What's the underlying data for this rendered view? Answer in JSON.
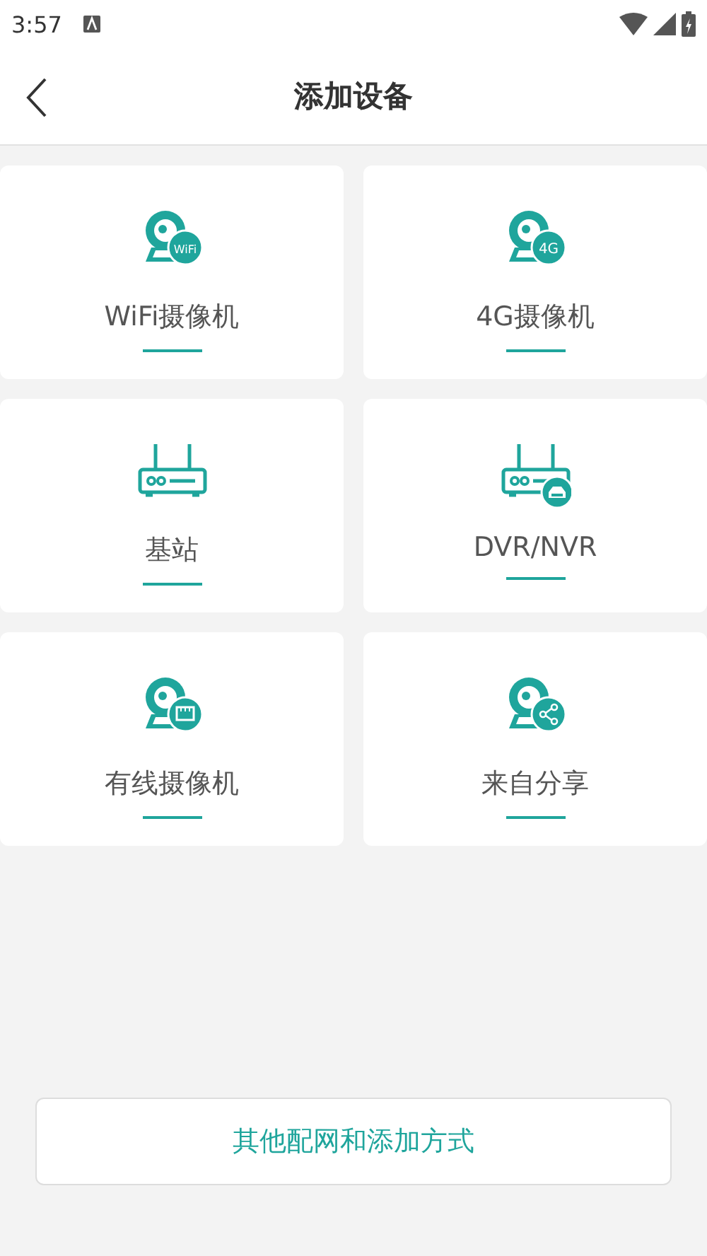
{
  "status_bar": {
    "time": "3:57"
  },
  "header": {
    "title": "添加设备"
  },
  "devices": [
    {
      "label": "WiFi摄像机",
      "kind": "camera",
      "badge": "WiFi"
    },
    {
      "label": "4G摄像机",
      "kind": "camera",
      "badge": "4G"
    },
    {
      "label": "基站",
      "kind": "router"
    },
    {
      "label": "DVR/NVR",
      "kind": "router-disk"
    },
    {
      "label": "有线摄像机",
      "kind": "camera-ethernet"
    },
    {
      "label": "来自分享",
      "kind": "camera-share"
    }
  ],
  "footer_button": "其他配网和添加方式"
}
